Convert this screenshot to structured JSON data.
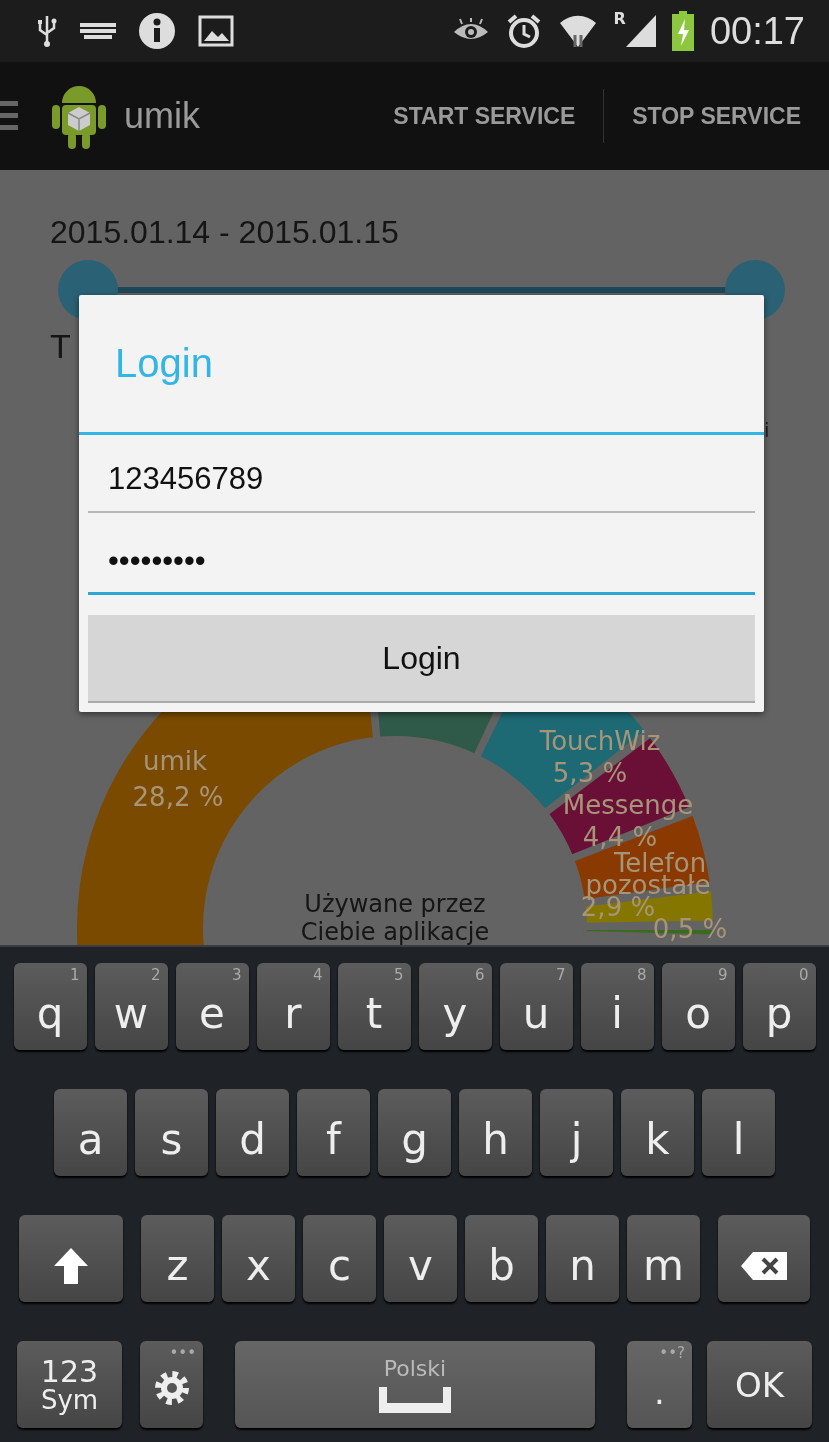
{
  "status_bar": {
    "network_badge": "R",
    "time": "00:17"
  },
  "app_bar": {
    "title": "umik",
    "actions": [
      "START SERVICE",
      "STOP SERVICE"
    ]
  },
  "background": {
    "date_range": "2015.01.14 - 2015.01.15",
    "range_slider": {
      "thumbs": [
        {
          "level": 0
        },
        {
          "level": 1
        }
      ]
    },
    "heading_fragment": "T",
    "side_fragment": "i",
    "donut_labels": [
      "umik",
      "28,2 %",
      "TouchWiz",
      "5,3 %",
      "Messenge",
      "4,4 %",
      "Telefon",
      "pozostałe",
      "2,9 %",
      "0,5 %"
    ],
    "center_lines": [
      "Używane przez",
      "Ciebie aplikacje"
    ]
  },
  "dialog": {
    "title": "Login",
    "fields": [
      {
        "value": "123456789",
        "focused": false
      },
      {
        "value": "•••••••••",
        "focused": true
      }
    ],
    "button": "Login"
  },
  "keyboard": {
    "rows": [
      {
        "keys": [
          {
            "kind": "letter",
            "label": "q",
            "hint": "1"
          },
          {
            "kind": "letter",
            "label": "w",
            "hint": "2"
          },
          {
            "kind": "letter",
            "label": "e",
            "hint": "3"
          },
          {
            "kind": "letter",
            "label": "r",
            "hint": "4"
          },
          {
            "kind": "letter",
            "label": "t",
            "hint": "5"
          },
          {
            "kind": "letter",
            "label": "y",
            "hint": "6"
          },
          {
            "kind": "letter",
            "label": "u",
            "hint": "7"
          },
          {
            "kind": "letter",
            "label": "i",
            "hint": "8"
          },
          {
            "kind": "letter",
            "label": "o",
            "hint": "9"
          },
          {
            "kind": "letter",
            "label": "p",
            "hint": "0"
          }
        ]
      },
      {
        "keys": [
          {
            "kind": "letter",
            "label": "a"
          },
          {
            "kind": "letter",
            "label": "s"
          },
          {
            "kind": "letter",
            "label": "d"
          },
          {
            "kind": "letter",
            "label": "f"
          },
          {
            "kind": "letter",
            "label": "g"
          },
          {
            "kind": "letter",
            "label": "h"
          },
          {
            "kind": "letter",
            "label": "j"
          },
          {
            "kind": "letter",
            "label": "k"
          },
          {
            "kind": "letter",
            "label": "l"
          }
        ]
      },
      {
        "keys": [
          {
            "kind": "shift"
          },
          {
            "kind": "letter",
            "label": "z"
          },
          {
            "kind": "letter",
            "label": "x"
          },
          {
            "kind": "letter",
            "label": "c"
          },
          {
            "kind": "letter",
            "label": "v"
          },
          {
            "kind": "letter",
            "label": "b"
          },
          {
            "kind": "letter",
            "label": "n"
          },
          {
            "kind": "letter",
            "label": "m"
          },
          {
            "kind": "backspace"
          }
        ]
      },
      {
        "keys": [
          {
            "kind": "sym",
            "lines": [
              "123",
              "Sym"
            ]
          },
          {
            "kind": "settings",
            "hint": "•••"
          },
          {
            "kind": "space",
            "label": "Polski"
          },
          {
            "kind": "period",
            "label": ".",
            "hint": "••?"
          },
          {
            "kind": "ok",
            "label": "OK"
          }
        ]
      }
    ]
  }
}
